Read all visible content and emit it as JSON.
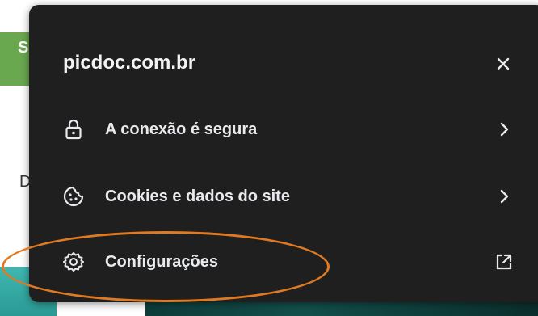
{
  "background": {
    "left_letter_top": "S",
    "left_letter_mid": "D"
  },
  "popup": {
    "site_title": "picdoc.com.br",
    "close_icon": "close-icon",
    "items": [
      {
        "label": "A conexão é segura",
        "icon": "lock-icon",
        "trailing_icon": "chevron-right-icon"
      },
      {
        "label": "Cookies e dados do site",
        "icon": "cookie-icon",
        "trailing_icon": "chevron-right-icon"
      },
      {
        "label": "Configurações",
        "icon": "gear-icon",
        "trailing_icon": "external-link-icon"
      }
    ]
  },
  "annotation": {
    "color": "#e07a22"
  },
  "colors": {
    "panel_bg": "#1f1f1f",
    "text": "#e8eaed",
    "accent_orange": "#e07a22"
  }
}
